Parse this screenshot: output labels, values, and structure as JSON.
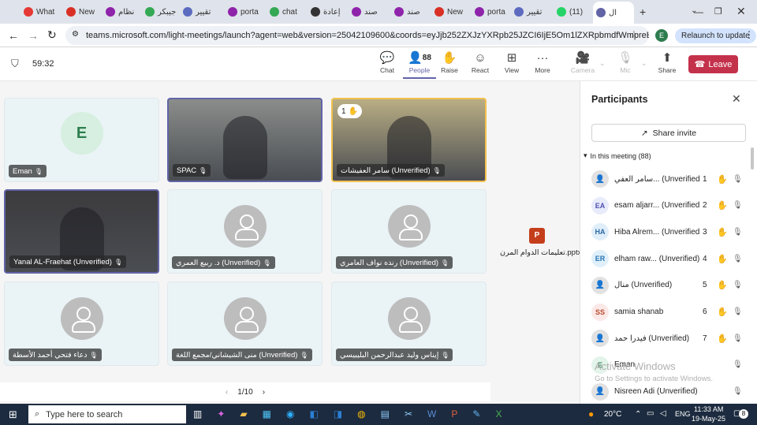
{
  "browser": {
    "tabs": [
      {
        "label": "What",
        "icon": "whatsapp-icon",
        "color": "#e53935"
      },
      {
        "label": "New",
        "icon": "gmail-icon",
        "color": "#d93025"
      },
      {
        "label": "نظام",
        "icon": "arrow-icon",
        "color": "#8e24aa"
      },
      {
        "label": "جيبكر",
        "icon": "google-icon",
        "color": "#34a853"
      },
      {
        "label": "تقيير",
        "icon": "doc-icon",
        "color": "#5c6bc0"
      },
      {
        "label": "porta",
        "icon": "portal-icon",
        "color": "#8e24aa"
      },
      {
        "label": "chat",
        "icon": "google-icon",
        "color": "#34a853"
      },
      {
        "label": "إعادة",
        "icon": "target-icon",
        "color": "#333333"
      },
      {
        "label": "صند",
        "icon": "portal-icon",
        "color": "#8e24aa"
      },
      {
        "label": "صند",
        "icon": "portal-icon",
        "color": "#8e24aa"
      },
      {
        "label": "New",
        "icon": "gmail-icon",
        "color": "#d93025"
      },
      {
        "label": "porta",
        "icon": "portal-icon",
        "color": "#8e24aa"
      },
      {
        "label": "تقيير",
        "icon": "doc-icon",
        "color": "#5c6bc0"
      },
      {
        "label": "(11)",
        "icon": "whatsapp-icon",
        "color": "#25d366"
      },
      {
        "label": "ال",
        "icon": "teams-icon",
        "color": "#6264a7"
      }
    ],
    "url": "teams.microsoft.com/light-meetings/launch?agent=web&version=25042109600&coords=eyJjb252ZXJzYXRpb25JZCI6IjE5Om1lZXRpbmdfWmpreE9USTNP...",
    "profile_initial": "E",
    "relaunch_label": "Relaunch to update"
  },
  "toolbar": {
    "timer": "59:32",
    "people_count": "88",
    "buttons": [
      "Chat",
      "People",
      "Raise",
      "React",
      "View",
      "More",
      "Camera",
      "Mic",
      "Share"
    ],
    "leave_label": "Leave"
  },
  "tiles": [
    {
      "name": "Eman",
      "initial": "E",
      "kind": "avatar"
    },
    {
      "name": "SPAC",
      "kind": "video",
      "tone": "#8a8d8a"
    },
    {
      "name": "سامر العفيشات (Unverified)",
      "kind": "video",
      "tone": "#b9ad84",
      "hand": "1"
    },
    {
      "name": "Yanal AL-Fraehat (Unverified)",
      "kind": "video",
      "tone": "#3c3b3e"
    },
    {
      "name": "د. ربيع العمري (Unverified)",
      "kind": "ghost"
    },
    {
      "name": "رنده نواف العامري (Unverified)",
      "kind": "ghost"
    },
    {
      "name": "دعاء فتحي أحمد الأسطة",
      "kind": "ghost"
    },
    {
      "name": "منى الشيشاني/مجمع اللغة (Unverified)",
      "kind": "ghost"
    },
    {
      "name": "إيناس وليد عبدالرحمن البليبيسي",
      "kind": "ghost"
    }
  ],
  "shared_file": {
    "name": "تعليمات الدوام المرن.pptx"
  },
  "pagination": "1/10",
  "panel": {
    "title": "Participants",
    "share_invite": "Share invite",
    "section": "In this meeting (88)",
    "participants": [
      {
        "name": "سامر العفي... (Unverified)",
        "initials": "",
        "num": "1",
        "bg": "#e1e1e1",
        "fg": "#616161"
      },
      {
        "name": "esam aljarr... (Unverified)",
        "initials": "EA",
        "num": "2",
        "bg": "#e8ebfa",
        "fg": "#4f52b2"
      },
      {
        "name": "Hiba Alrem... (Unverified)",
        "initials": "HA",
        "num": "3",
        "bg": "#e0eefa",
        "fg": "#2b6aa8"
      },
      {
        "name": "elham raw... (Unverified)",
        "initials": "ER",
        "num": "4",
        "bg": "#e0f0fa",
        "fg": "#2674b8"
      },
      {
        "name": "منال (Unverified)",
        "initials": "",
        "num": "5",
        "bg": "#e1e1e1",
        "fg": "#616161"
      },
      {
        "name": "samia shanab",
        "initials": "SS",
        "num": "6",
        "bg": "#fbe9e7",
        "fg": "#b74a2f"
      },
      {
        "name": "فيدرا حمد (Unverified)",
        "initials": "",
        "num": "7",
        "bg": "#e1e1e1",
        "fg": "#616161"
      },
      {
        "name": "Eman",
        "initials": "E",
        "num": "",
        "bg": "#e3f4ea",
        "fg": "#2e7d4f"
      },
      {
        "name": "Nisreen Adi (Unverified)",
        "initials": "",
        "num": "",
        "bg": "#e1e1e1",
        "fg": "#616161"
      }
    ],
    "watermark_title": "Activate Windows",
    "watermark_sub": "Go to Settings to activate Windows."
  },
  "taskbar": {
    "search_placeholder": "Type here to search",
    "weather": "20°C",
    "lang": "ENG",
    "time": "11:33 AM",
    "date": "19-May-25",
    "notifications": "8"
  }
}
